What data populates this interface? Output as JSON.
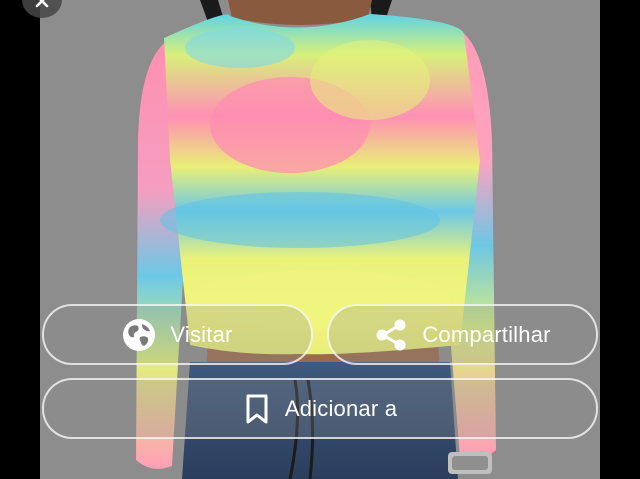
{
  "actions": {
    "visit_label": "Visitar",
    "share_label": "Compartilhar",
    "add_label": "Adicionar a"
  },
  "icons": {
    "close": "close-icon",
    "visit": "globe-icon",
    "share": "share-icon",
    "add": "bookmark-icon"
  },
  "colors": {
    "background": "#000000",
    "photo_background": "#8d8d8d",
    "button_border": "#ffffff",
    "button_text": "#ffffff"
  }
}
